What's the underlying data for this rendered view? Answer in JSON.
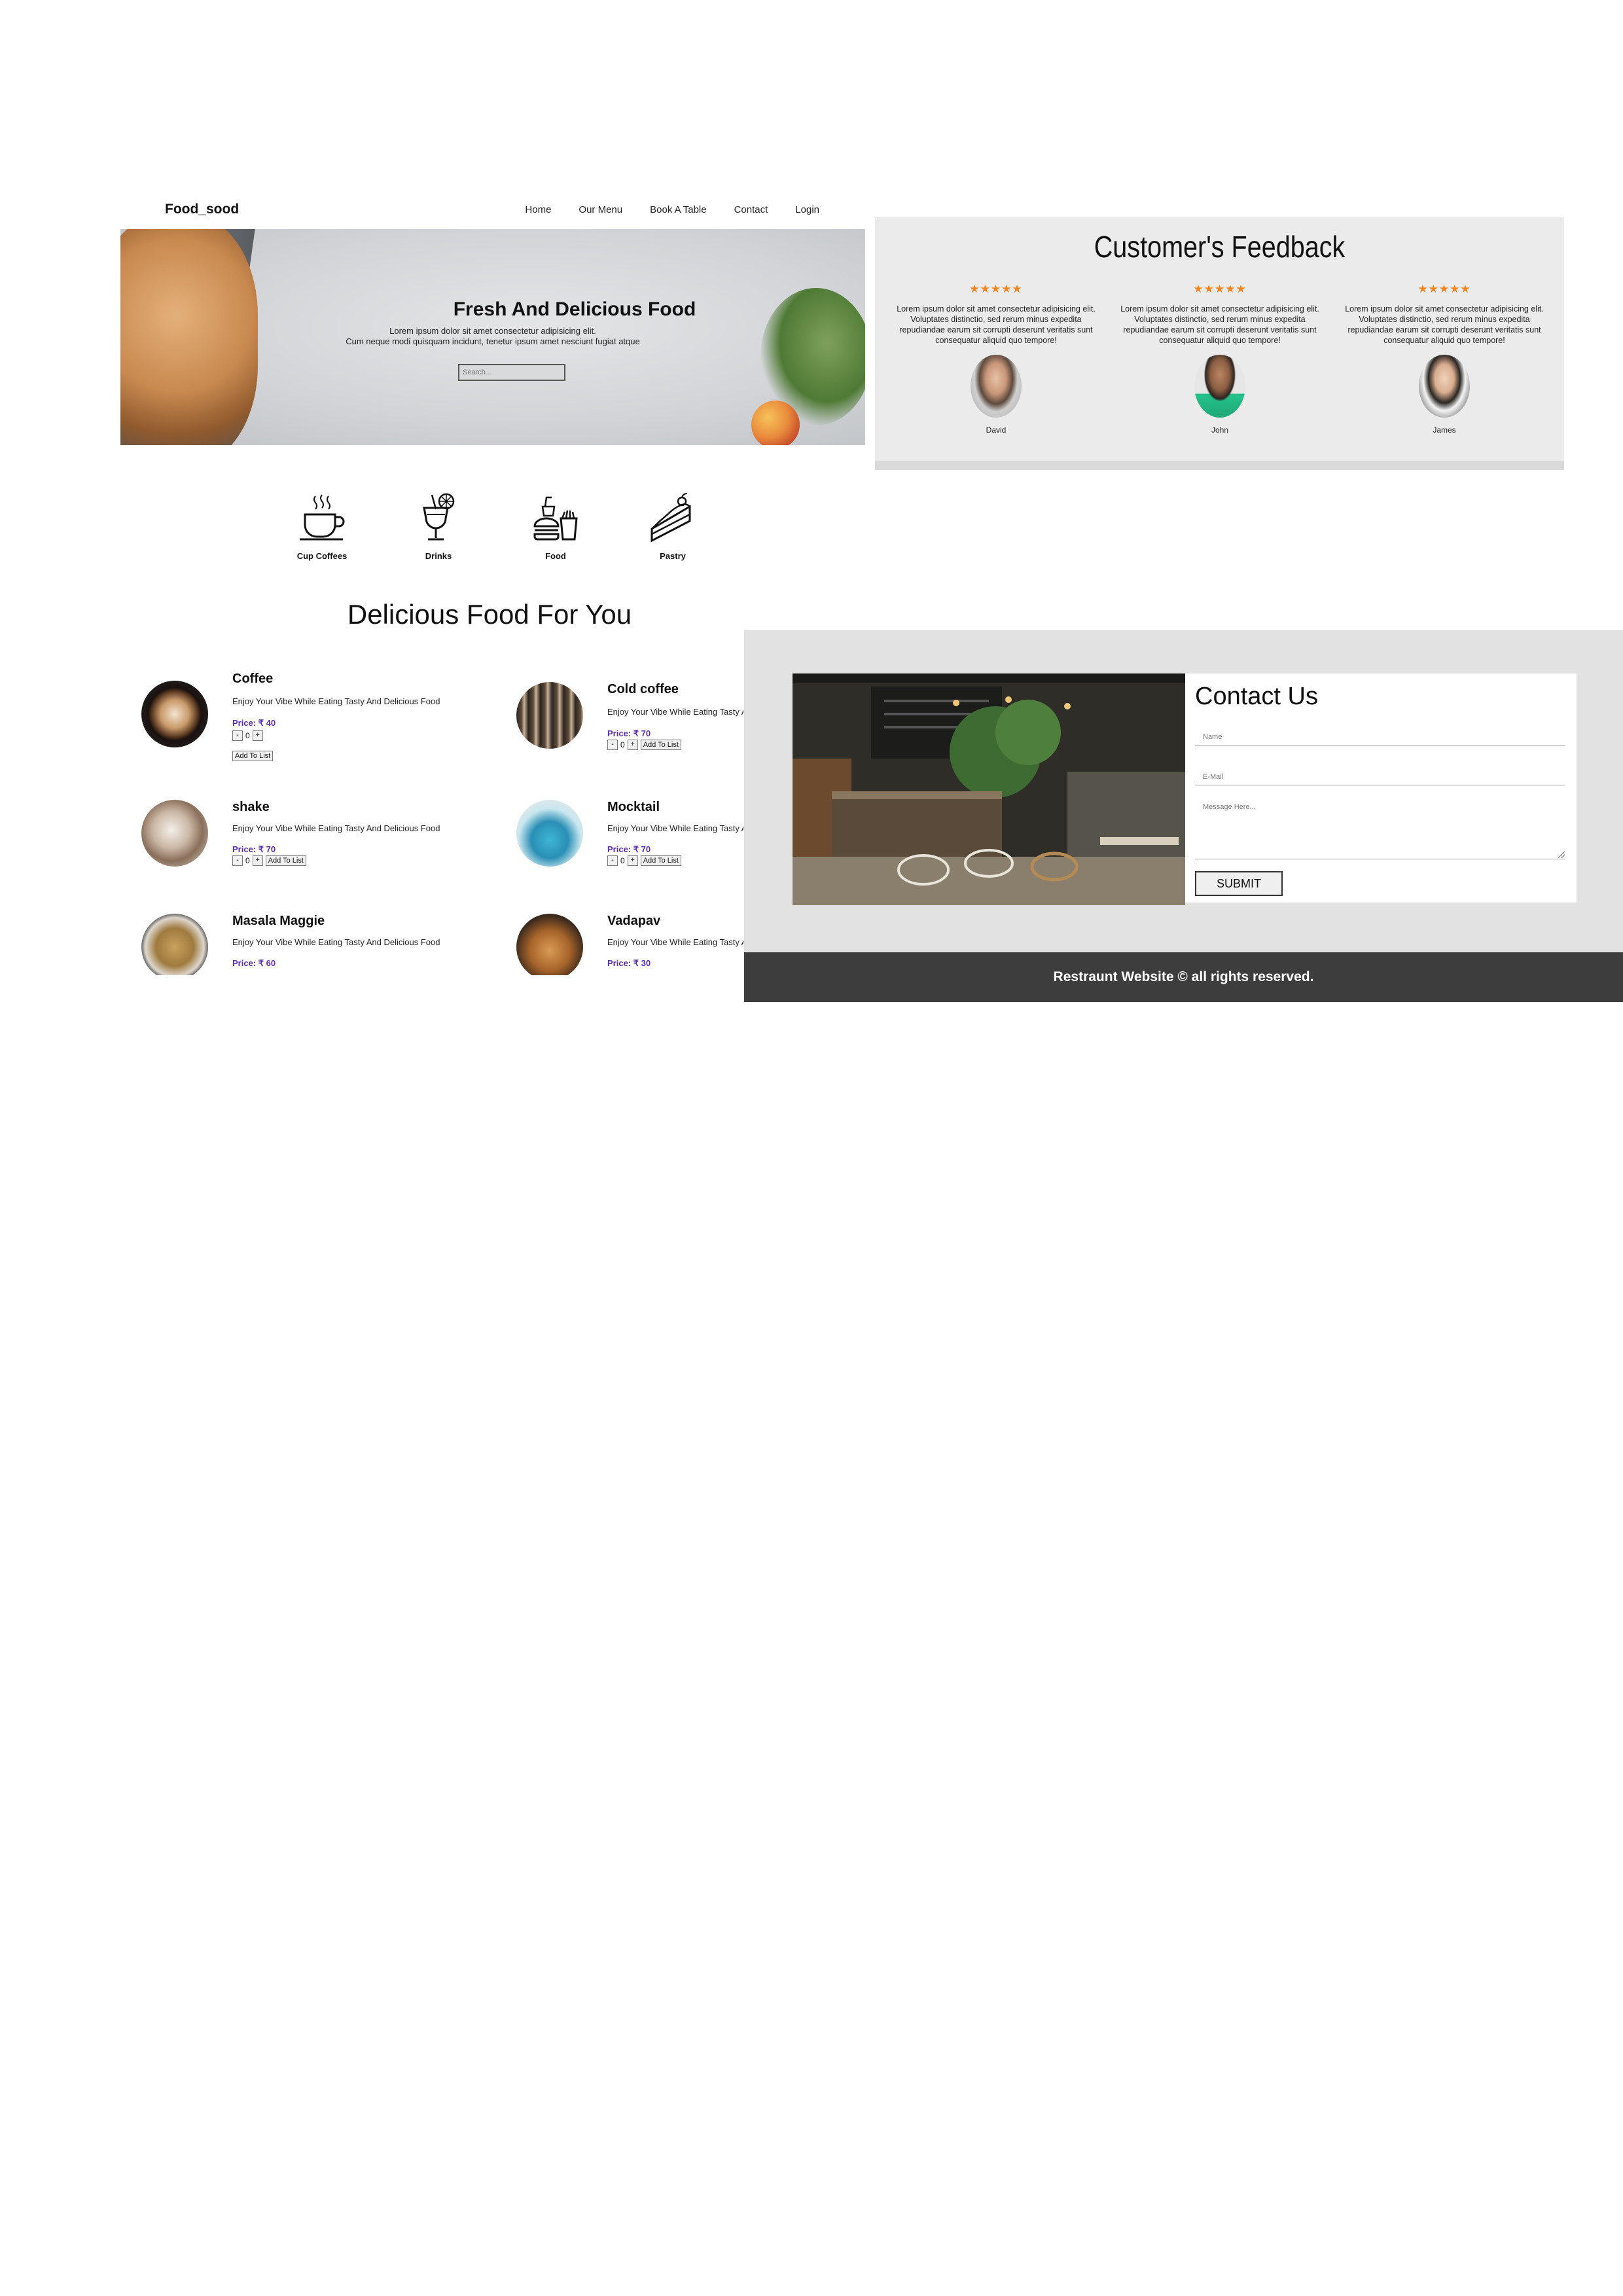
{
  "nav": {
    "brand": "Food_sood",
    "links": [
      "Home",
      "Our Menu",
      "Book A Table",
      "Contact",
      "Login"
    ]
  },
  "hero": {
    "title": "Fresh And Delicious Food",
    "line1": "Lorem ipsum dolor sit amet consectetur adipisicing elit.",
    "line2": "Cum neque modi quisquam incidunt, tenetur ipsum amet nesciunt fugiat atque",
    "search_placeholder": "Search..."
  },
  "categories": [
    {
      "label": "Cup Coffees",
      "icon": "coffee-cup-icon"
    },
    {
      "label": "Drinks",
      "icon": "drink-glass-icon"
    },
    {
      "label": "Food",
      "icon": "burger-fries-icon"
    },
    {
      "label": "Pastry",
      "icon": "cake-slice-icon"
    }
  ],
  "menu_section": {
    "title": "Delicious Food For You",
    "items": [
      {
        "name": "Coffee",
        "desc": "Enjoy Your Vibe While Eating Tasty And Delicious Food",
        "price": "Price: ₹ 40",
        "qty": "0",
        "add": "Add To List"
      },
      {
        "name": "Cold coffee",
        "desc": "Enjoy Your Vibe While Eating Tasty And Delicious Food",
        "price": "Price: ₹ 70",
        "qty": "0",
        "add": "Add To List"
      },
      {
        "name": "shake",
        "desc": "Enjoy Your Vibe While Eating Tasty And Delicious Food",
        "price": "Price: ₹ 70",
        "qty": "0",
        "add": "Add To List"
      },
      {
        "name": "Mocktail",
        "desc": "Enjoy Your Vibe While Eating Tasty And Delicious Food",
        "price": "Price: ₹ 70",
        "qty": "0",
        "add": "Add To List"
      },
      {
        "name": "Masala Maggie",
        "desc": "Enjoy Your Vibe While Eating Tasty And Delicious Food",
        "price": "Price: ₹ 60"
      },
      {
        "name": "Vadapav",
        "desc": "Enjoy Your Vibe While Eating Tasty And Delicious Food",
        "price": "Price: ₹ 30"
      }
    ],
    "minus": "-",
    "plus": "+"
  },
  "feedback": {
    "title": "Customer's Feedback",
    "stars": "★★★★★",
    "star_color": "#f0831e",
    "reviews": [
      {
        "text": "Lorem ipsum dolor sit amet consectetur adipisicing elit. Voluptates distinctio, sed rerum minus expedita repudiandae earum sit corrupti deserunt veritatis sunt consequatur aliquid quo tempore!",
        "name": "David"
      },
      {
        "text": "Lorem ipsum dolor sit amet consectetur adipisicing elit. Voluptates distinctio, sed rerum minus expedita repudiandae earum sit corrupti deserunt veritatis sunt consequatur aliquid quo tempore!",
        "name": "John"
      },
      {
        "text": "Lorem ipsum dolor sit amet consectetur adipisicing elit. Voluptates distinctio, sed rerum minus expedita repudiandae earum sit corrupti deserunt veritatis sunt consequatur aliquid quo tempore!",
        "name": "James"
      }
    ]
  },
  "contact": {
    "title": "Contact Us",
    "name_placeholder": "Name",
    "email_placeholder": "E-Mail",
    "message_placeholder": "Message Here...",
    "submit": "SUBMIT"
  },
  "footer": {
    "text": "Restraunt Website © all rights reserved."
  },
  "colors": {
    "price": "#5a2ea6",
    "footer_bg": "#3d3d3d",
    "contact_band": "#e2e2e2",
    "feedback_bg": "#ebebeb"
  }
}
